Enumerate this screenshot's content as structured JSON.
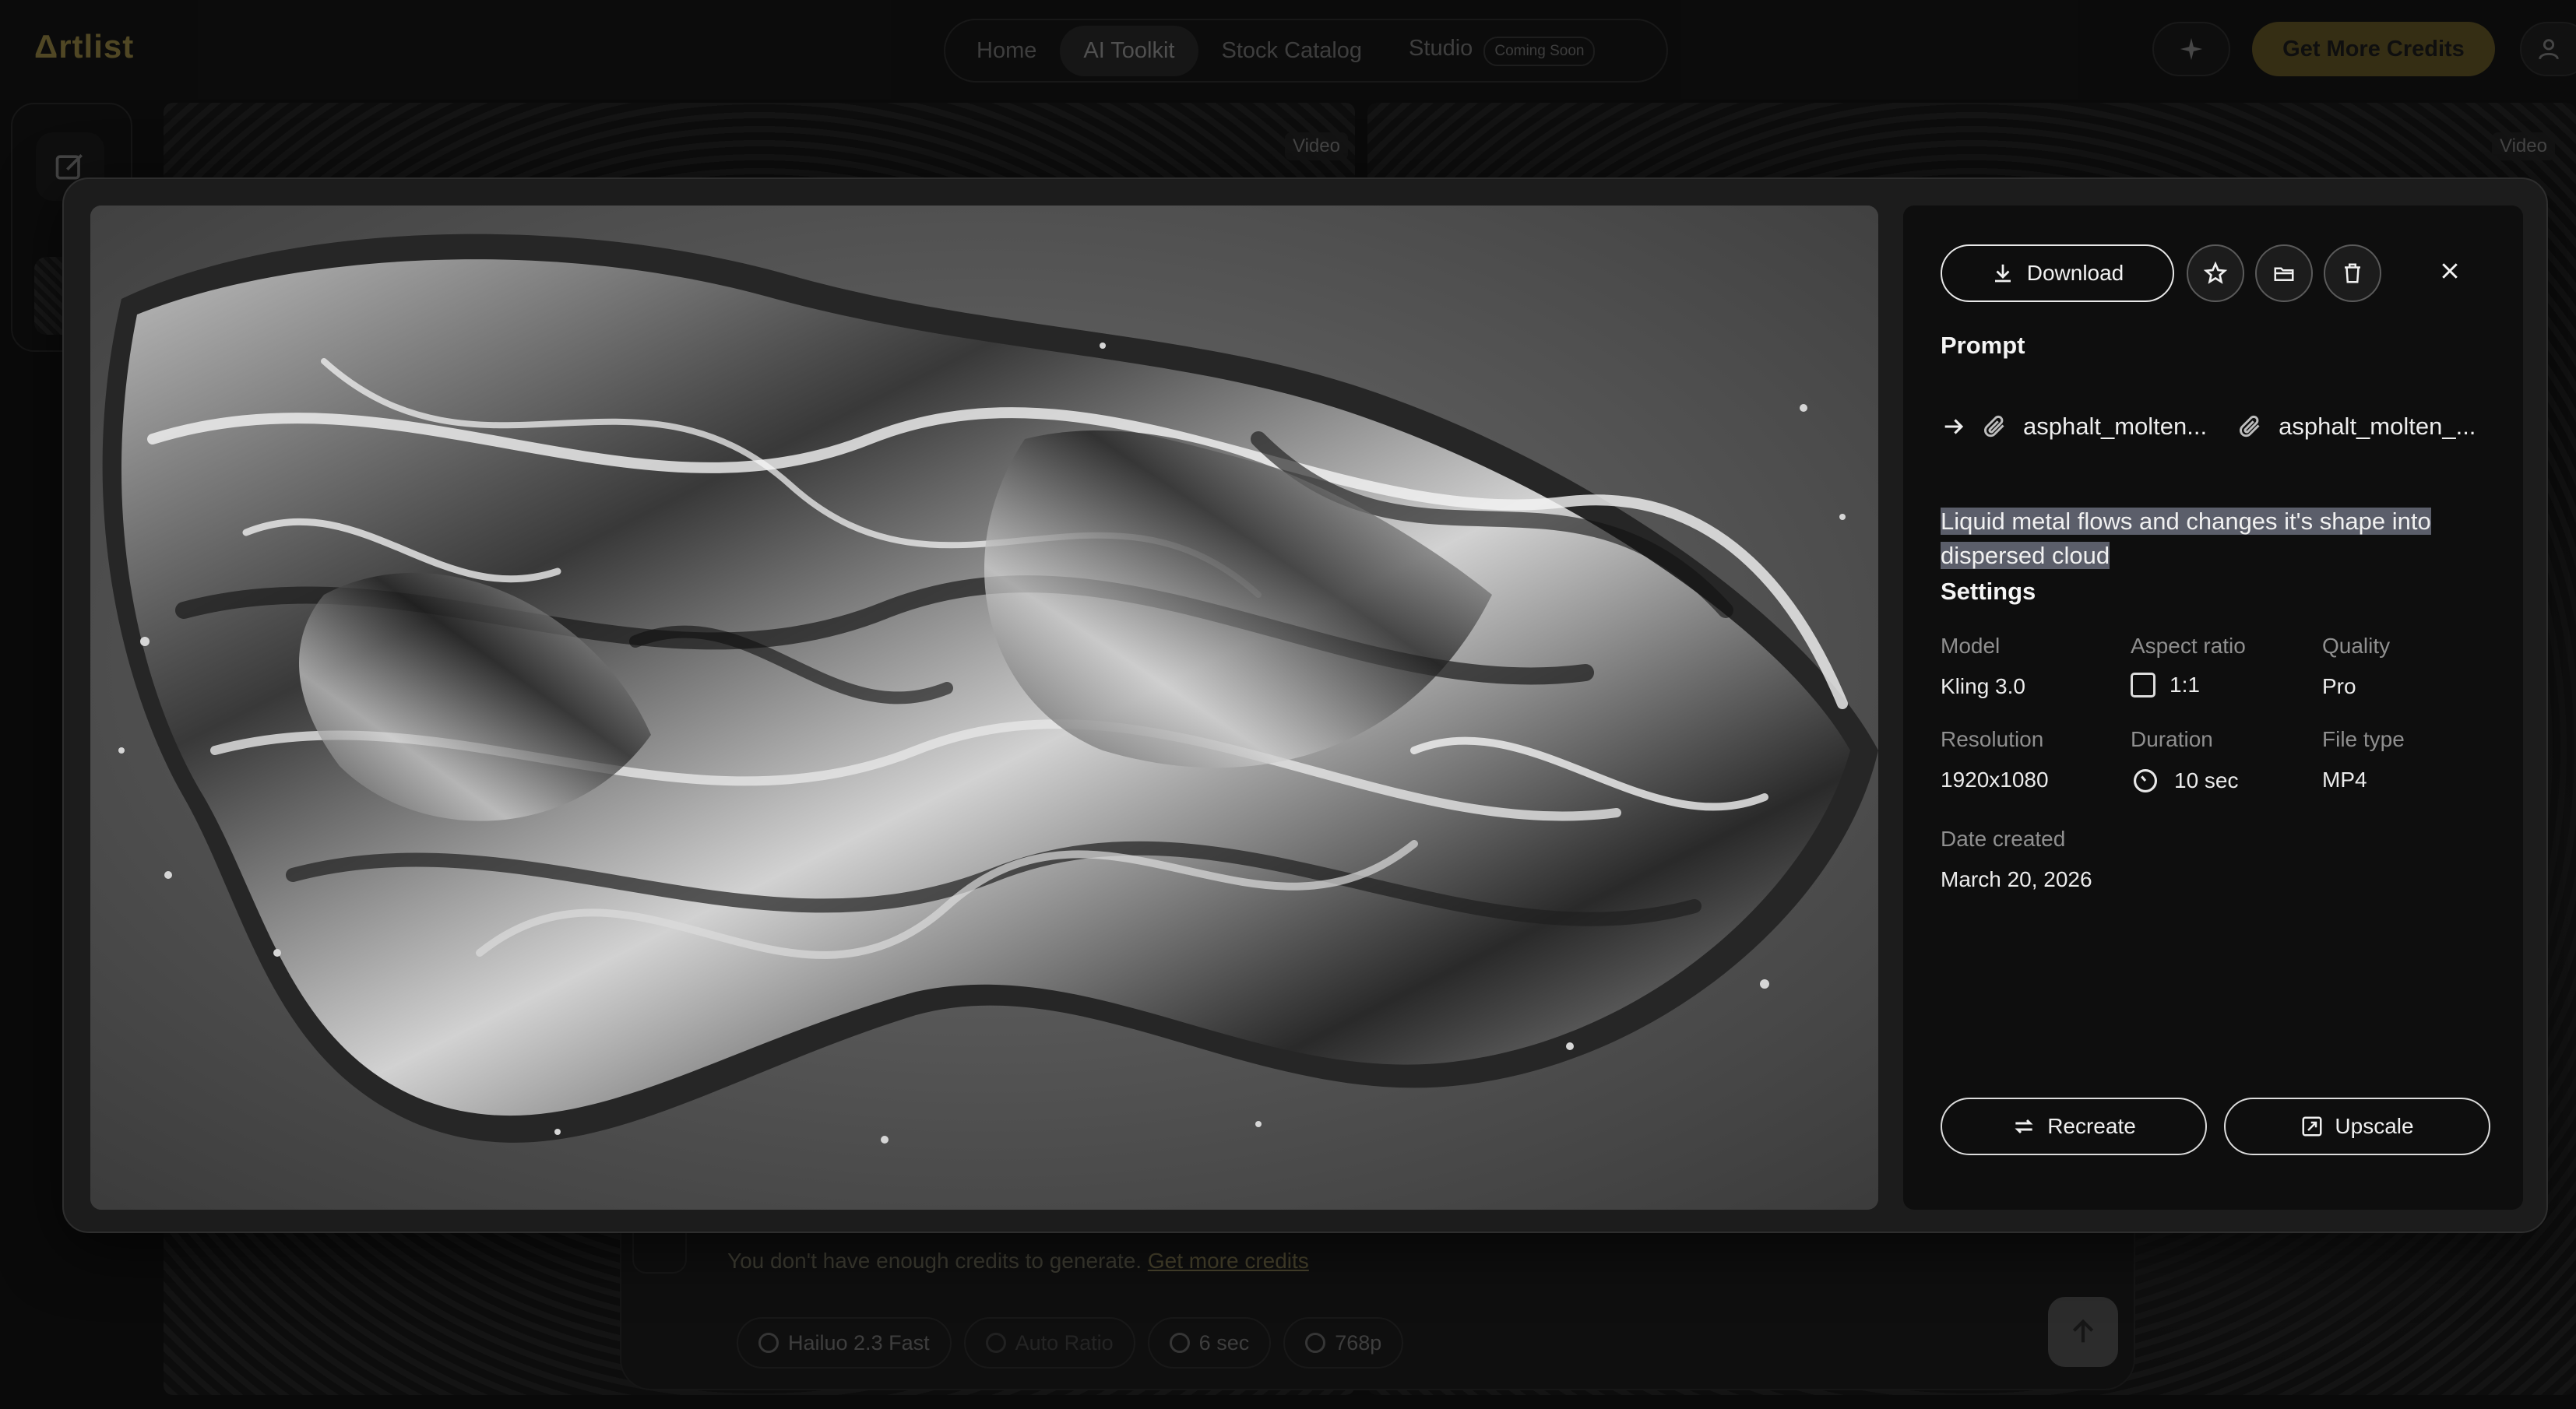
{
  "app": {
    "logo": "Δrtlist",
    "nav": [
      {
        "label": "Home",
        "active": false
      },
      {
        "label": "AI Toolkit",
        "active": true
      },
      {
        "label": "Stock Catalog",
        "active": false
      },
      {
        "label": "Studio",
        "active": false,
        "badge": "Coming Soon"
      }
    ],
    "credits_button": "Get More Credits",
    "tile_badge": "Video"
  },
  "composer": {
    "warning": "You don't have enough credits to generate.",
    "warning_link": "Get more credits",
    "chips": [
      "Hailuo 2.3 Fast",
      "Auto Ratio",
      "6 sec",
      "768p"
    ]
  },
  "modal": {
    "actions": {
      "download": "Download",
      "favorite_icon": "star-icon",
      "folder_icon": "folder-icon",
      "delete_icon": "trash-icon",
      "close_icon": "close-icon"
    },
    "prompt": {
      "title": "Prompt",
      "references": [
        "asphalt_molten...",
        "asphalt_molten_..."
      ],
      "text": "Liquid metal flows and changes it's shape into dispersed cloud"
    },
    "settings": {
      "title": "Settings",
      "model": {
        "label": "Model",
        "value": "Kling 3.0"
      },
      "aspect_ratio": {
        "label": "Aspect ratio",
        "value": "1:1"
      },
      "quality": {
        "label": "Quality",
        "value": "Pro"
      },
      "resolution": {
        "label": "Resolution",
        "value": "1920x1080"
      },
      "duration": {
        "label": "Duration",
        "value": "10 sec"
      },
      "file_type": {
        "label": "File type",
        "value": "MP4"
      },
      "date_created": {
        "label": "Date created",
        "value": "March 20, 2026"
      }
    },
    "buttons": {
      "recreate": "Recreate",
      "upscale": "Upscale"
    }
  }
}
